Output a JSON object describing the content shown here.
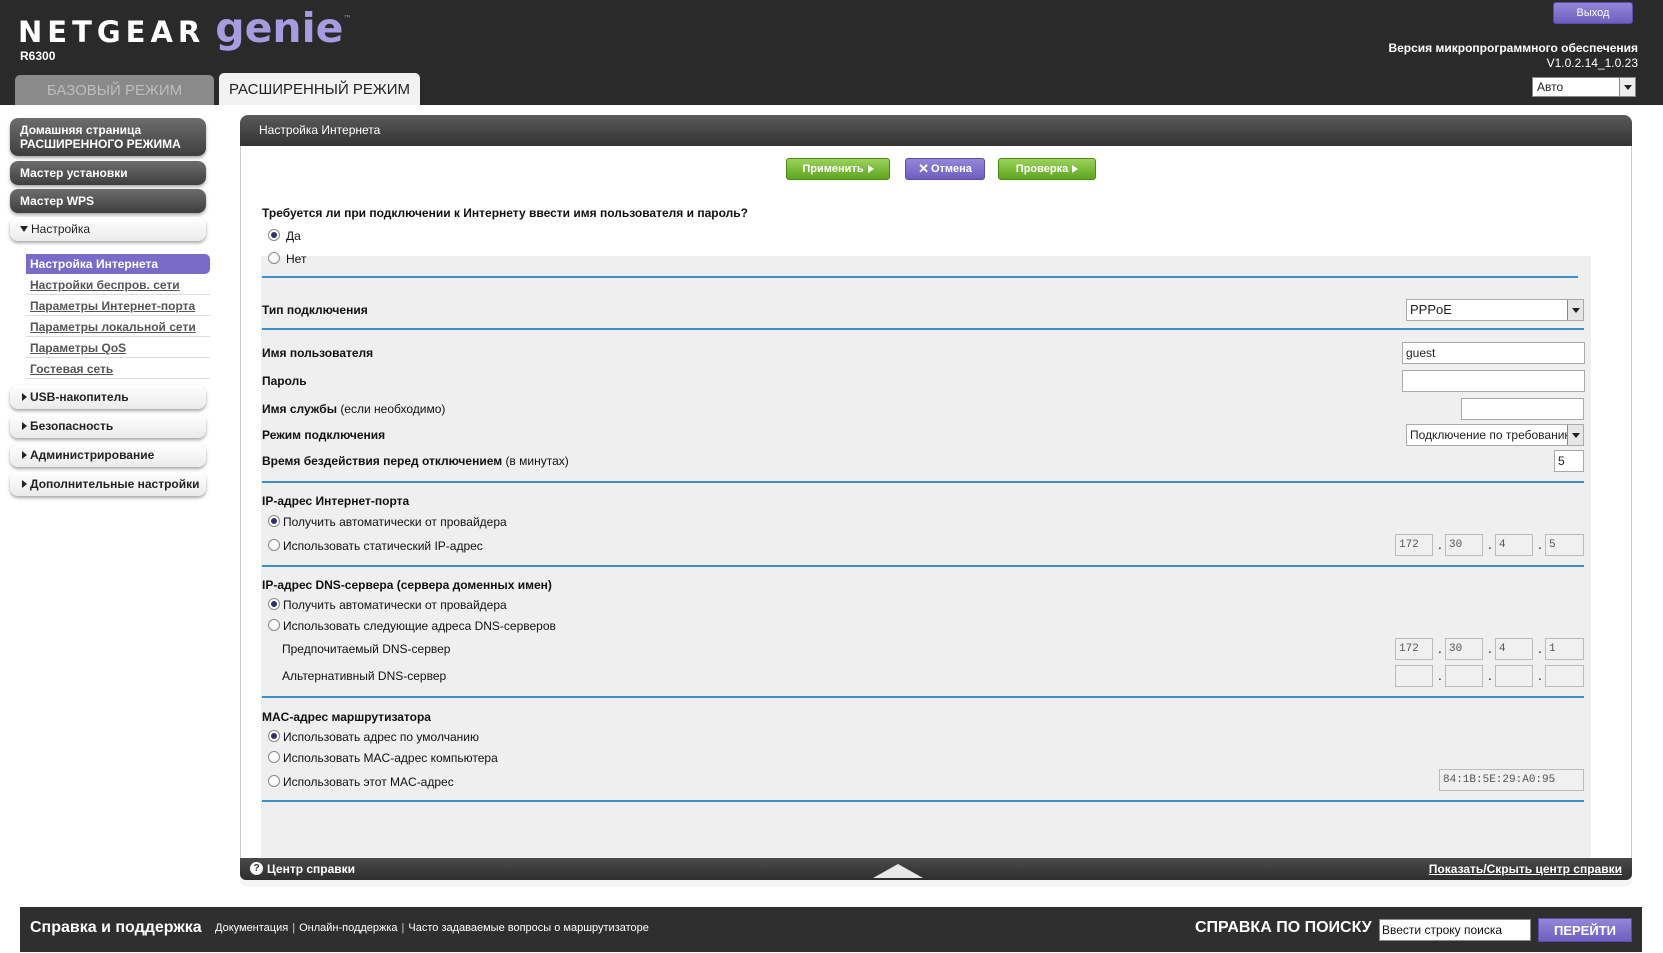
{
  "header": {
    "brand": "NETGEAR",
    "product": "genie",
    "trademark": "™",
    "model": "R6300",
    "logout_label": "Выход",
    "firmware_label": "Версия микропрограммного обеспечения",
    "firmware_version": "V1.0.2.14_1.0.23",
    "language": "Авто"
  },
  "tabs": {
    "basic": "БАЗОВЫЙ РЕЖИМ",
    "advanced": "РАСШИРЕННЫЙ РЕЖИМ"
  },
  "sidebar": {
    "home_line1": "Домашняя страница",
    "home_line2": "РАСШИРЕННОГО РЕЖИМА",
    "setup_wizard": "Мастер установки",
    "wps_wizard": "Мастер WPS",
    "setup": "Настройка",
    "setup_items": [
      "Настройка Интернета",
      "Настройки беспров. сети",
      "Параметры Интернет-порта",
      "Параметры локальной сети",
      "Параметры QoS",
      "Гостевая сеть"
    ],
    "usb": "USB-накопитель",
    "security": "Безопасность",
    "admin": "Администрирование",
    "advanced_settings": "Дополнительные настройки"
  },
  "panel": {
    "title": "Настройка Интернета",
    "apply": "Применить",
    "cancel": "Отмена",
    "test": "Проверка",
    "login_question": "Требуется ли при подключении к Интернету ввести имя пользователя и пароль?",
    "yes": "Да",
    "no": "Нет",
    "connection_type_label": "Тип подключения",
    "connection_type": "PPPoE",
    "username_label": "Имя пользователя",
    "username": "guest",
    "password_label": "Пароль",
    "service_label": "Имя службы",
    "service_note": "(если необходимо)",
    "mode_label": "Режим подключения",
    "mode": "Подключение по требованию",
    "idle_label": "Время бездействия перед отключением",
    "idle_note": "(в минутах)",
    "idle": "5",
    "ip_section": "IP-адрес Интернет-порта",
    "ip_auto": "Получить автоматически от провайдера",
    "ip_static": "Использовать статический IP-адрес",
    "ip": [
      "172",
      "30",
      "4",
      "5"
    ],
    "dns_section": "IP-адрес DNS-сервера (сервера доменных имен)",
    "dns_auto": "Получить автоматически от провайдера",
    "dns_manual": "Использовать следующие адреса DNS-серверов",
    "dns_primary_label": "Предпочитаемый DNS-сервер",
    "dns_primary": [
      "172",
      "30",
      "4",
      "1"
    ],
    "dns_secondary_label": "Альтернативный DNS-сервер",
    "dns_secondary": [
      "",
      "",
      "",
      ""
    ],
    "mac_section": "MAC-адрес маршрутизатора",
    "mac_default": "Использовать адрес по умолчанию",
    "mac_computer": "Использовать MAC-адрес компьютера",
    "mac_this": "Использовать этот MAC-адрес",
    "mac": "84:1B:5E:29:A0:95",
    "help_center": "Центр справки",
    "help_toggle": "Показать/Скрыть центр справки"
  },
  "footer": {
    "support_title": "Справка и поддержка",
    "links": [
      "Документация",
      "Онлайн-поддержка",
      "Часто задаваемые вопросы о маршрутизаторе"
    ],
    "search_title": "СПРАВКА ПО ПОИСКУ",
    "search_placeholder": "Ввести строку поиска",
    "search_button": "ПЕРЕЙТИ"
  },
  "colors": {
    "accent_purple": "#7a6bc9",
    "button_green": "#6cb528",
    "divider_blue": "#3a92c4",
    "header_dark": "#2a2a2a"
  }
}
